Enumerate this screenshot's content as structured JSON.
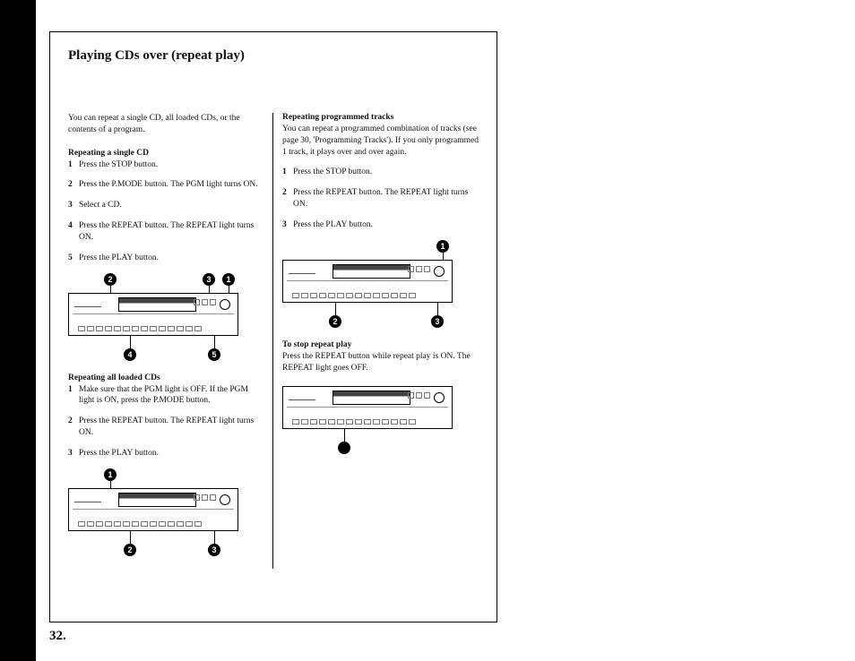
{
  "page": {
    "title": "Playing CDs over (repeat play)",
    "number": "32."
  },
  "left": {
    "intro": "You can repeat a single CD, all loaded CDs, or the contents of a program.",
    "section1": {
      "heading": "Repeating a single CD",
      "steps": [
        "Press the STOP button.",
        "Press the P.MODE button. The PGM light turns ON.",
        "Select a CD.",
        "Press the REPEAT button. The REPEAT light turns ON.",
        "Press the PLAY button."
      ]
    },
    "section2": {
      "heading": "Repeating all loaded CDs",
      "steps": [
        "Make sure that the PGM light is OFF. If the PGM light is ON, press the P.MODE button.",
        "Press the REPEAT button. The REPEAT light turns ON.",
        "Press the PLAY button."
      ]
    }
  },
  "right": {
    "section1": {
      "heading": "Repeating programmed tracks",
      "intro": "You can repeat a programmed combination of tracks (see page 30, 'Programming Tracks'). If you only programmed 1 track, it plays over and over again.",
      "steps": [
        "Press the STOP button.",
        "Press the REPEAT button. The REPEAT light turns ON.",
        "Press the PLAY button."
      ]
    },
    "section2": {
      "heading": "To stop repeat play",
      "body": "Press the REPEAT button while repeat play is ON. The REPEAT light goes OFF."
    }
  },
  "callouts": {
    "d1_top": [
      "2",
      "3",
      "1"
    ],
    "d1_bot": [
      "4",
      "5"
    ],
    "d2_top": [
      "1"
    ],
    "d2_bot": [
      "2",
      "3"
    ],
    "d3_top": [
      "1"
    ],
    "d3_bot": [
      "2",
      "3"
    ]
  }
}
